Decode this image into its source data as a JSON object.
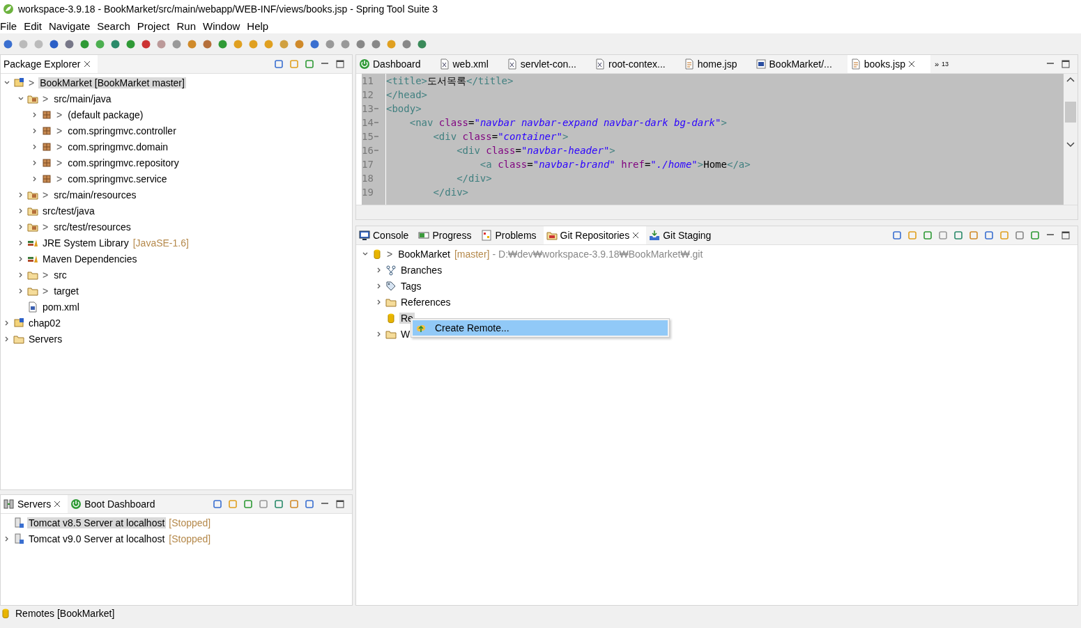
{
  "window": {
    "title": "workspace-3.9.18 - BookMarket/src/main/webapp/WEB-INF/views/books.jsp - Spring Tool Suite 3"
  },
  "menu": [
    "File",
    "Edit",
    "Navigate",
    "Search",
    "Project",
    "Run",
    "Window",
    "Help"
  ],
  "explorer": {
    "tabs": [
      {
        "label": "Package Explorer",
        "selected": true,
        "closable": true
      }
    ],
    "items": [
      {
        "label": "BookMarket [BookMarket master]",
        "kind": "project",
        "decoration": ">",
        "selected": true,
        "expanded": true,
        "children": [
          {
            "label": "src/main/java",
            "kind": "srcfolder",
            "decoration": ">",
            "selected": false,
            "expanded": true,
            "children": [
              {
                "label": "(default package)",
                "kind": "package",
                "decoration": ">",
                "selected": false,
                "expanded": false
              },
              {
                "label": "com.springmvc.controller",
                "kind": "package",
                "decoration": ">",
                "selected": false,
                "expanded": false
              },
              {
                "label": "com.springmvc.domain",
                "kind": "package",
                "decoration": ">",
                "selected": false,
                "expanded": false
              },
              {
                "label": "com.springmvc.repository",
                "kind": "package",
                "decoration": ">",
                "selected": false,
                "expanded": false
              },
              {
                "label": "com.springmvc.service",
                "kind": "package",
                "decoration": ">",
                "selected": false,
                "expanded": false
              }
            ]
          },
          {
            "label": "src/main/resources",
            "kind": "srcfolder",
            "decoration": ">",
            "selected": false,
            "expanded": false
          },
          {
            "label": "src/test/java",
            "kind": "srcfolder",
            "selected": false,
            "expanded": false
          },
          {
            "label": "src/test/resources",
            "kind": "srcfolder",
            "decoration": ">",
            "selected": false,
            "expanded": false
          },
          {
            "label": "JRE System Library",
            "note": "[JavaSE-1.6]",
            "kind": "library",
            "selected": false,
            "expanded": false
          },
          {
            "label": "Maven Dependencies",
            "kind": "library",
            "selected": false,
            "expanded": false
          },
          {
            "label": "src",
            "kind": "folder",
            "decoration": ">",
            "selected": false,
            "expanded": false
          },
          {
            "label": "target",
            "kind": "folder",
            "decoration": ">",
            "selected": false,
            "expanded": false
          },
          {
            "label": "pom.xml",
            "kind": "file",
            "selected": false
          }
        ]
      },
      {
        "label": "chap02",
        "kind": "project",
        "selected": false,
        "expanded": false
      },
      {
        "label": "Servers",
        "kind": "folder",
        "selected": false,
        "expanded": false
      }
    ]
  },
  "editor": {
    "tabs": [
      {
        "label": "Dashboard",
        "kind": "spring",
        "selected": false,
        "closable": false
      },
      {
        "label": "web.xml",
        "kind": "xml",
        "selected": false,
        "closable": false
      },
      {
        "label": "servlet-con...",
        "kind": "xml",
        "selected": false,
        "closable": false
      },
      {
        "label": "root-contex...",
        "kind": "xml",
        "selected": false,
        "closable": false
      },
      {
        "label": "home.jsp",
        "kind": "jsp",
        "selected": false,
        "closable": false
      },
      {
        "label": "BookMarket/...",
        "kind": "maven",
        "selected": false,
        "closable": false
      },
      {
        "label": "books.jsp",
        "kind": "jsp",
        "selected": true,
        "closable": true
      }
    ],
    "overflow": {
      "glyph": "»",
      "count": "13"
    },
    "lines": [
      {
        "number": "11",
        "fold": false,
        "tokens": [
          {
            "kind": "tag",
            "text": "<title>"
          },
          {
            "kind": "text",
            "text": "도서목록"
          },
          {
            "kind": "tag",
            "text": "</title>"
          }
        ]
      },
      {
        "number": "12",
        "fold": false,
        "tokens": [
          {
            "kind": "tag",
            "text": "</head>"
          }
        ]
      },
      {
        "number": "13",
        "fold": true,
        "tokens": [
          {
            "kind": "tag",
            "text": "<body>"
          }
        ]
      },
      {
        "number": "14",
        "fold": true,
        "tokens": [
          {
            "kind": "tag",
            "text": "    <nav "
          },
          {
            "kind": "attr",
            "text": "class"
          },
          {
            "kind": "text",
            "text": "="
          },
          {
            "kind": "str",
            "text": "\"navbar navbar-expand navbar-dark bg-dark\""
          },
          {
            "kind": "tag",
            "text": ">"
          }
        ]
      },
      {
        "number": "15",
        "fold": true,
        "tokens": [
          {
            "kind": "tag",
            "text": "        <div "
          },
          {
            "kind": "attr",
            "text": "class"
          },
          {
            "kind": "text",
            "text": "="
          },
          {
            "kind": "str",
            "text": "\"container\""
          },
          {
            "kind": "tag",
            "text": ">"
          }
        ]
      },
      {
        "number": "16",
        "fold": true,
        "tokens": [
          {
            "kind": "tag",
            "text": "            <div "
          },
          {
            "kind": "attr",
            "text": "class"
          },
          {
            "kind": "text",
            "text": "="
          },
          {
            "kind": "str",
            "text": "\"navbar-header\""
          },
          {
            "kind": "tag",
            "text": ">"
          }
        ]
      },
      {
        "number": "17",
        "fold": false,
        "tokens": [
          {
            "kind": "tag",
            "text": "                <a "
          },
          {
            "kind": "attr",
            "text": "class"
          },
          {
            "kind": "text",
            "text": "="
          },
          {
            "kind": "str",
            "text": "\"navbar-brand\""
          },
          {
            "kind": "attr",
            "text": " href"
          },
          {
            "kind": "text",
            "text": "="
          },
          {
            "kind": "str",
            "text": "\"./home\""
          },
          {
            "kind": "tag",
            "text": ">"
          },
          {
            "kind": "text",
            "text": "Home"
          },
          {
            "kind": "tag",
            "text": "</a>"
          }
        ]
      },
      {
        "number": "18",
        "fold": false,
        "tokens": [
          {
            "kind": "tag",
            "text": "            </div>"
          }
        ]
      },
      {
        "number": "19",
        "fold": false,
        "tokens": [
          {
            "kind": "tag",
            "text": "        </div>"
          }
        ]
      }
    ]
  },
  "git": {
    "tabs": [
      {
        "label": "Console",
        "kind": "console",
        "selected": false,
        "closable": false
      },
      {
        "label": "Progress",
        "kind": "progress",
        "selected": false,
        "closable": false
      },
      {
        "label": "Problems",
        "kind": "problems",
        "selected": false,
        "closable": false
      },
      {
        "label": "Git Repositories",
        "kind": "git",
        "selected": true,
        "closable": true
      },
      {
        "label": "Git Staging",
        "kind": "staging",
        "selected": false,
        "closable": false
      }
    ],
    "items": [
      {
        "label": "BookMarket",
        "note": "[master]",
        "path": "- D:₩dev₩workspace-3.9.18₩BookMarket₩.git",
        "kind": "repo",
        "decoration": ">",
        "selected": false,
        "expanded": true,
        "children": [
          {
            "label": "Branches",
            "kind": "branches",
            "selected": false,
            "expanded": false
          },
          {
            "label": "Tags",
            "kind": "tags",
            "selected": false,
            "expanded": false
          },
          {
            "label": "References",
            "kind": "folder",
            "selected": false,
            "expanded": false
          },
          {
            "label": "Re",
            "kind": "repo",
            "selected": true
          },
          {
            "label": "W",
            "kind": "folder",
            "selected": false,
            "expanded": false
          }
        ]
      }
    ],
    "context_menu": [
      {
        "label": "Create Remote...",
        "selected": true
      }
    ]
  },
  "servers": {
    "tabs": [
      {
        "label": "Servers",
        "kind": "servers",
        "selected": true,
        "closable": true
      },
      {
        "label": "Boot Dashboard",
        "kind": "spring",
        "selected": false,
        "closable": false
      }
    ],
    "items": [
      {
        "label": "Tomcat v8.5 Server at localhost",
        "note": "[Stopped]",
        "kind": "server",
        "selected": true
      },
      {
        "label": "Tomcat v9.0 Server at localhost",
        "note": "[Stopped]",
        "kind": "server",
        "selected": false,
        "expanded": false
      }
    ]
  },
  "status_bar": {
    "text": "Remotes [BookMarket]"
  }
}
